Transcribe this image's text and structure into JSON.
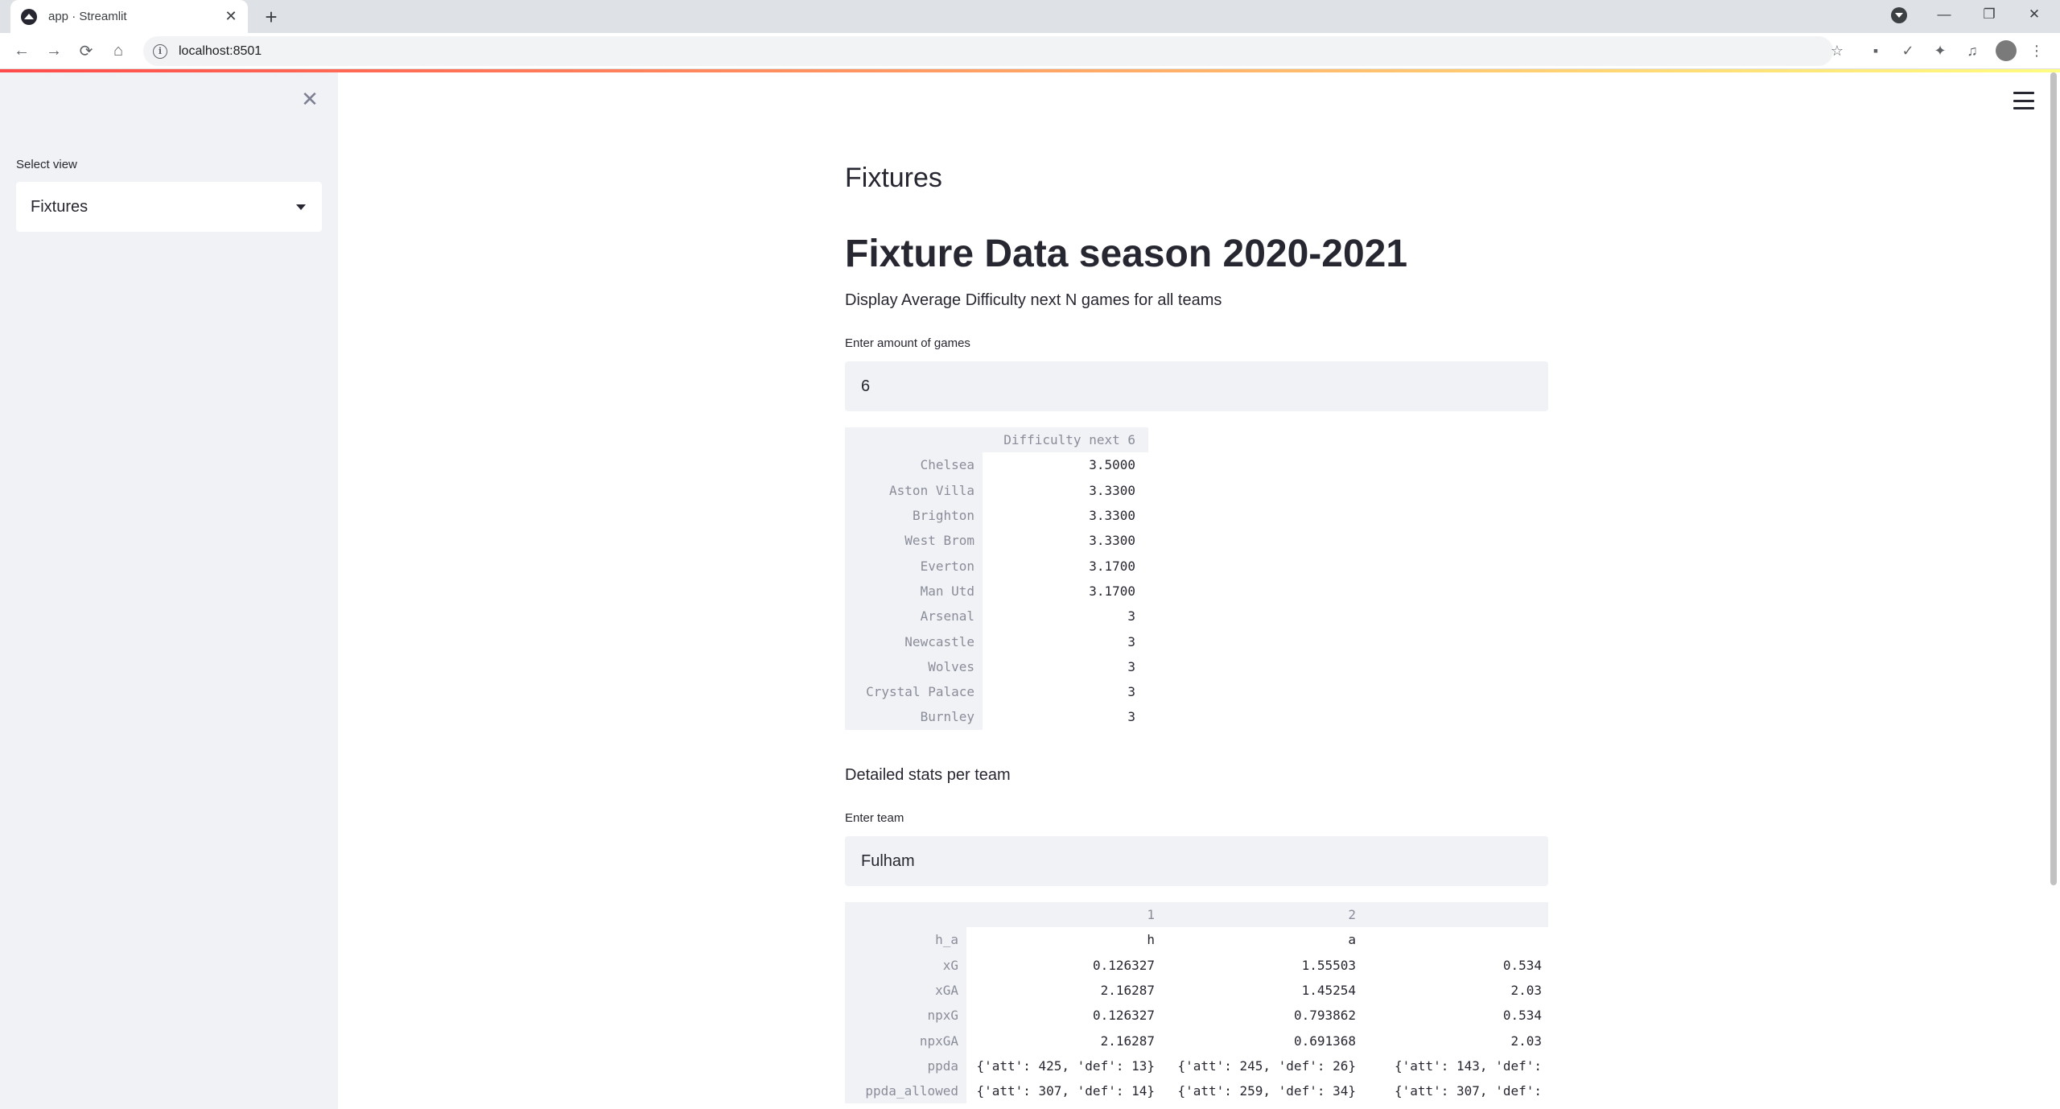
{
  "browser": {
    "tab_title": "app · Streamlit",
    "url": "localhost:8501"
  },
  "sidebar": {
    "select_label": "Select view",
    "select_value": "Fixtures"
  },
  "main": {
    "subheader": "Fixtures",
    "title": "Fixture Data season 2020-2021",
    "description": "Display Average Difficulty next N games for all teams",
    "games_input": {
      "label": "Enter amount of games",
      "value": "6"
    },
    "difficulty_table": {
      "column": "Difficulty next 6",
      "rows": [
        {
          "team": "Chelsea",
          "value": "3.5000"
        },
        {
          "team": "Aston Villa",
          "value": "3.3300"
        },
        {
          "team": "Brighton",
          "value": "3.3300"
        },
        {
          "team": "West Brom",
          "value": "3.3300"
        },
        {
          "team": "Everton",
          "value": "3.1700"
        },
        {
          "team": "Man Utd",
          "value": "3.1700"
        },
        {
          "team": "Arsenal",
          "value": "3"
        },
        {
          "team": "Newcastle",
          "value": "3"
        },
        {
          "team": "Wolves",
          "value": "3"
        },
        {
          "team": "Crystal Palace",
          "value": "3"
        },
        {
          "team": "Burnley",
          "value": "3"
        }
      ]
    },
    "detailed_heading": "Detailed stats per team",
    "team_input": {
      "label": "Enter team",
      "value": "Fulham"
    },
    "team_table": {
      "columns": [
        "1",
        "2",
        ""
      ],
      "rows": [
        {
          "index": "h_a",
          "cells": [
            "h",
            "a",
            ""
          ]
        },
        {
          "index": "xG",
          "cells": [
            "0.126327",
            "1.55503",
            "0.534"
          ]
        },
        {
          "index": "xGA",
          "cells": [
            "2.16287",
            "1.45254",
            "2.03"
          ]
        },
        {
          "index": "npxG",
          "cells": [
            "0.126327",
            "0.793862",
            "0.534"
          ]
        },
        {
          "index": "npxGA",
          "cells": [
            "2.16287",
            "0.691368",
            "2.03"
          ]
        },
        {
          "index": "ppda",
          "cells": [
            "{'att': 425, 'def': 13}",
            "{'att': 245, 'def': 26}",
            "{'att': 143, 'def': "
          ]
        },
        {
          "index": "ppda_allowed",
          "cells": [
            "{'att': 307, 'def': 14}",
            "{'att': 259, 'def': 34}",
            "{'att': 307, 'def': "
          ]
        }
      ]
    }
  },
  "colors": {
    "accent": "#ff4b4b",
    "sidebar_bg": "#f0f2f6",
    "text": "#262730"
  }
}
